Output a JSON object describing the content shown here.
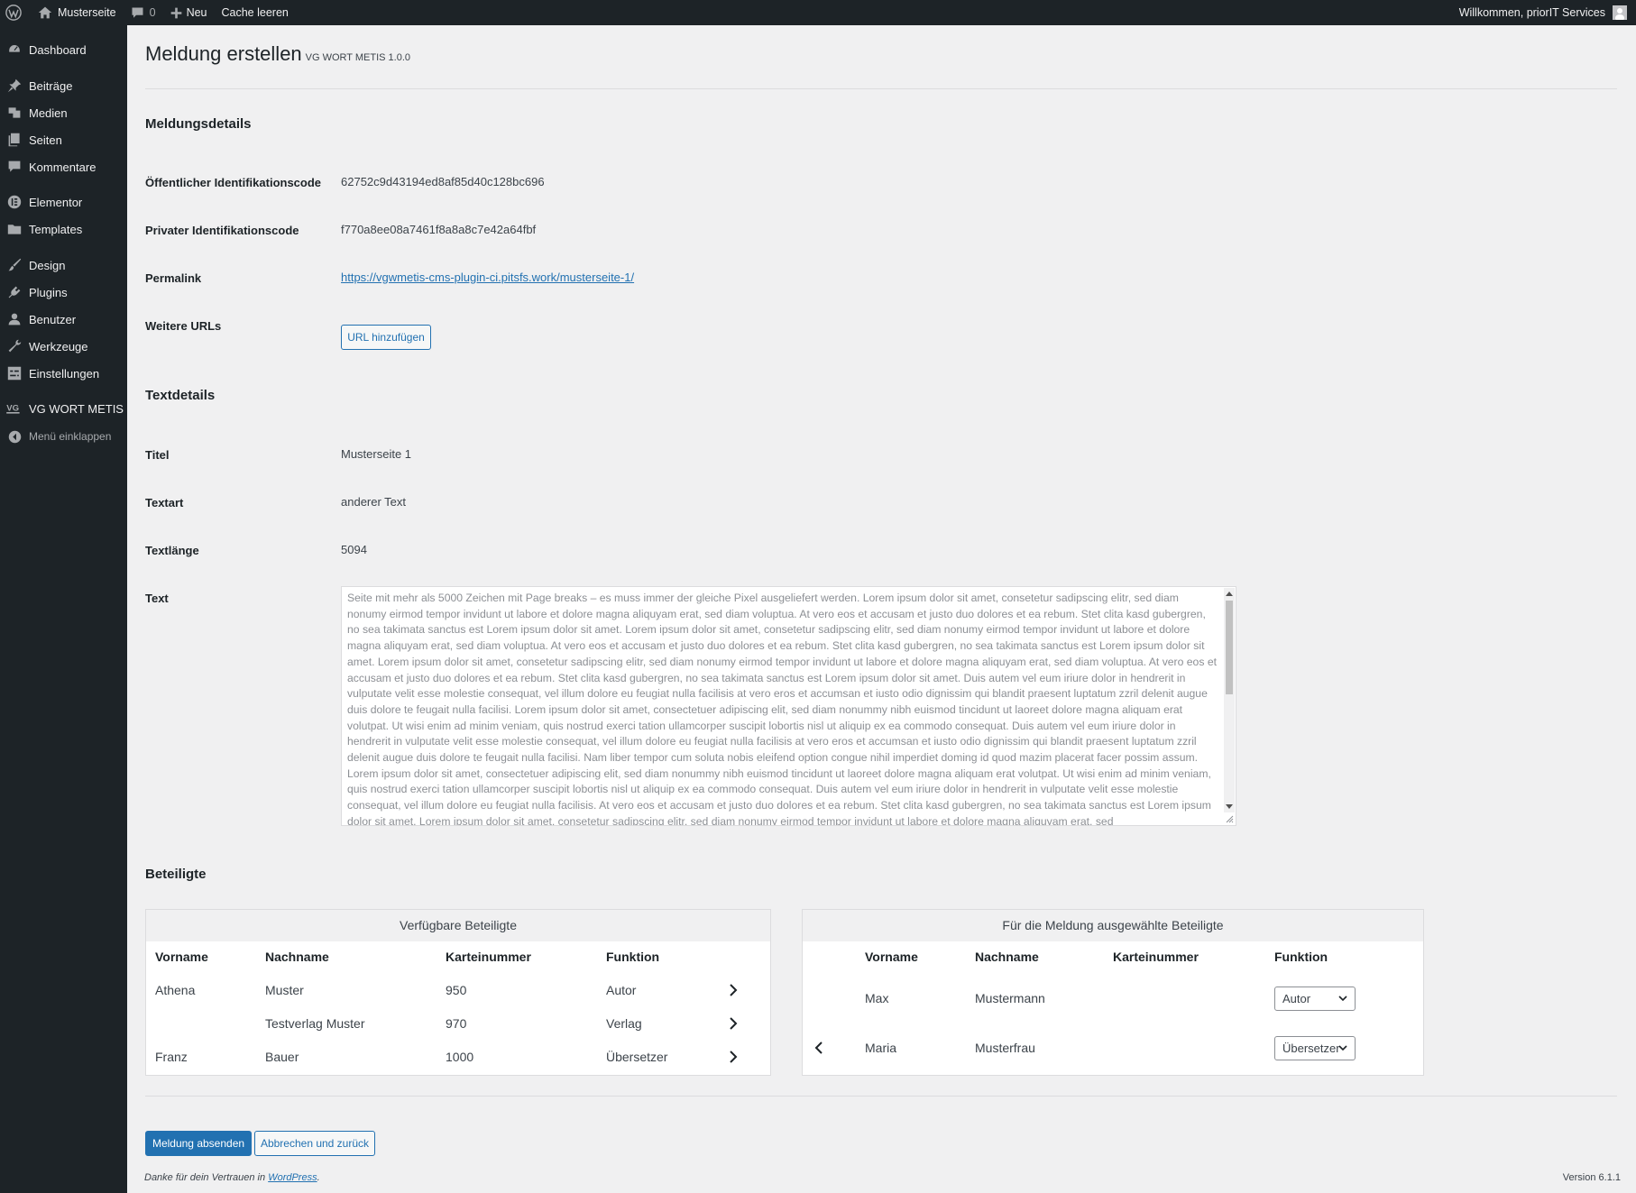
{
  "adminbar": {
    "site_name": "Musterseite",
    "comments_count": "0",
    "new_label": "Neu",
    "cache_label": "Cache leeren",
    "greeting": "Willkommen, priorIT Services"
  },
  "sidebar": {
    "items": [
      {
        "label": "Dashboard",
        "icon": "dashboard-icon"
      },
      {
        "label": "Beiträge",
        "icon": "pin-icon"
      },
      {
        "label": "Medien",
        "icon": "media-icon"
      },
      {
        "label": "Seiten",
        "icon": "pages-icon"
      },
      {
        "label": "Kommentare",
        "icon": "comments-icon"
      },
      {
        "label": "Elementor",
        "icon": "elementor-icon"
      },
      {
        "label": "Templates",
        "icon": "folder-icon"
      },
      {
        "label": "Design",
        "icon": "brush-icon"
      },
      {
        "label": "Plugins",
        "icon": "plugin-icon"
      },
      {
        "label": "Benutzer",
        "icon": "user-icon"
      },
      {
        "label": "Werkzeuge",
        "icon": "wrench-icon"
      },
      {
        "label": "Einstellungen",
        "icon": "settings-icon"
      },
      {
        "label": "VG WORT METIS",
        "icon": "vgwort-icon"
      }
    ],
    "collapse_label": "Menü einklappen"
  },
  "page": {
    "title": "Meldung erstellen",
    "version": "VG WORT METIS 1.0.0"
  },
  "meldungsdetails": {
    "heading": "Meldungsdetails",
    "public_code_label": "Öffentlicher Identifikationscode",
    "public_code": "62752c9d43194ed8af85d40c128bc696",
    "private_code_label": "Privater Identifikationscode",
    "private_code": "f770a8ee08a7461f8a8a8c7e42a64fbf",
    "permalink_label": "Permalink",
    "permalink": "https://vgwmetis-cms-plugin-ci.pitsfs.work/musterseite-1/",
    "urls_label": "Weitere URLs",
    "add_url_button": "URL hinzufügen"
  },
  "textdetails": {
    "heading": "Textdetails",
    "title_label": "Titel",
    "title": "Musterseite 1",
    "type_label": "Textart",
    "type": "anderer Text",
    "length_label": "Textlänge",
    "length": "5094",
    "text_label": "Text",
    "text": "Seite mit mehr als 5000 Zeichen mit Page breaks – es muss immer der gleiche Pixel ausgeliefert werden. Lorem ipsum dolor sit amet, consetetur sadipscing elitr, sed diam nonumy eirmod tempor invidunt ut labore et dolore magna aliquyam erat, sed diam voluptua. At vero eos et accusam et justo duo dolores et ea rebum. Stet clita kasd gubergren, no sea takimata sanctus est Lorem ipsum dolor sit amet. Lorem ipsum dolor sit amet, consetetur sadipscing elitr, sed diam nonumy eirmod tempor invidunt ut labore et dolore magna aliquyam erat, sed diam voluptua. At vero eos et accusam et justo duo dolores et ea rebum. Stet clita kasd gubergren, no sea takimata sanctus est Lorem ipsum dolor sit amet. Lorem ipsum dolor sit amet, consetetur sadipscing elitr, sed diam nonumy eirmod tempor invidunt ut labore et dolore magna aliquyam erat, sed diam voluptua. At vero eos et accusam et justo duo dolores et ea rebum. Stet clita kasd gubergren, no sea takimata sanctus est Lorem ipsum dolor sit amet. Duis autem vel eum iriure dolor in hendrerit in vulputate velit esse molestie consequat, vel illum dolore eu feugiat nulla facilisis at vero eros et accumsan et iusto odio dignissim qui blandit praesent luptatum zzril delenit augue duis dolore te feugait nulla facilisi. Lorem ipsum dolor sit amet, consectetuer adipiscing elit, sed diam nonummy nibh euismod tincidunt ut laoreet dolore magna aliquam erat volutpat. Ut wisi enim ad minim veniam, quis nostrud exerci tation ullamcorper suscipit lobortis nisl ut aliquip ex ea commodo consequat. Duis autem vel eum iriure dolor in hendrerit in vulputate velit esse molestie consequat, vel illum dolore eu feugiat nulla facilisis at vero eros et accumsan et iusto odio dignissim qui blandit praesent luptatum zzril delenit augue duis dolore te feugait nulla facilisi. Nam liber tempor cum soluta nobis eleifend option congue nihil imperdiet doming id quod mazim placerat facer possim assum. Lorem ipsum dolor sit amet, consectetuer adipiscing elit, sed diam nonummy nibh euismod tincidunt ut laoreet dolore magna aliquam erat volutpat. Ut wisi enim ad minim veniam, quis nostrud exerci tation ullamcorper suscipit lobortis nisl ut aliquip ex ea commodo consequat. Duis autem vel eum iriure dolor in hendrerit in vulputate velit esse molestie consequat, vel illum dolore eu feugiat nulla facilisis. At vero eos et accusam et justo duo dolores et ea rebum. Stet clita kasd gubergren, no sea takimata sanctus est Lorem ipsum dolor sit amet. Lorem ipsum dolor sit amet, consetetur sadipscing elitr, sed diam nonumy eirmod tempor invidunt ut labore et dolore magna aliquyam erat, sed"
  },
  "beteiligte": {
    "heading": "Beteiligte",
    "available": {
      "heading": "Verfügbare Beteiligte",
      "columns": [
        "Vorname",
        "Nachname",
        "Karteinummer",
        "Funktion"
      ],
      "rows": [
        {
          "vorname": "Athena",
          "nachname": "Muster",
          "karteinummer": "950",
          "funktion": "Autor"
        },
        {
          "vorname": "",
          "nachname": "Testverlag Muster",
          "karteinummer": "970",
          "funktion": "Verlag"
        },
        {
          "vorname": "Franz",
          "nachname": "Bauer",
          "karteinummer": "1000",
          "funktion": "Übersetzer"
        }
      ]
    },
    "selected": {
      "heading": "Für die Meldung ausgewählte Beteiligte",
      "columns": [
        "Vorname",
        "Nachname",
        "Karteinummer",
        "Funktion"
      ],
      "rows": [
        {
          "vorname": "Max",
          "nachname": "Mustermann",
          "karteinummer": "",
          "funktion": "Autor"
        },
        {
          "vorname": "Maria",
          "nachname": "Musterfrau",
          "karteinummer": "",
          "funktion": "Übersetzer"
        }
      ]
    }
  },
  "actions": {
    "submit": "Meldung absenden",
    "cancel": "Abbrechen und zurück"
  },
  "footer": {
    "thanks_prefix": "Danke für dein Vertrauen in ",
    "wordpress": "WordPress",
    "thanks_suffix": ".",
    "version": "Version 6.1.1"
  },
  "colors": {
    "admin_dark": "#1d2327",
    "accent_blue": "#2271b1",
    "background": "#f0f0f1"
  }
}
